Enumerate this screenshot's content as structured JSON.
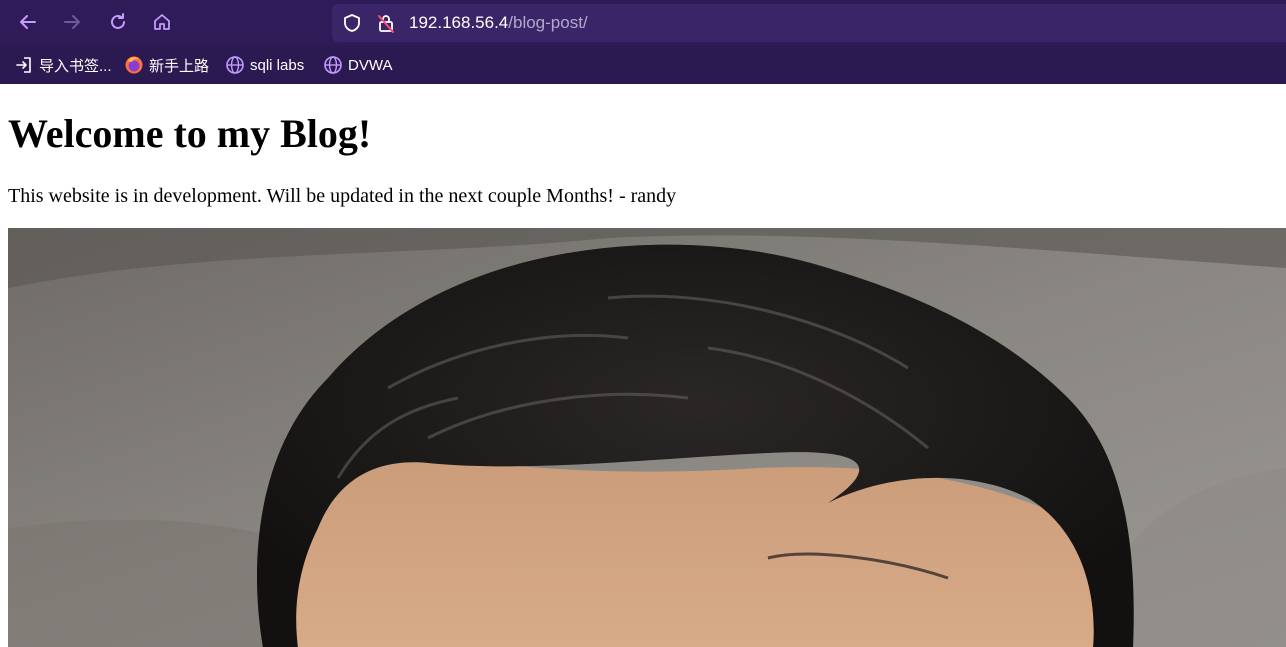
{
  "browser": {
    "url_host": "192.168.56.4",
    "url_path": "/blog-post/",
    "theme_color": "#2b1a52",
    "icon_color": "#c49bff",
    "bookmarks": [
      {
        "label": "导入书签...",
        "icon": "import-bookmarks-icon"
      },
      {
        "label": "新手上路",
        "icon": "firefox-icon"
      },
      {
        "label": "sqli labs",
        "icon": "globe-icon"
      },
      {
        "label": "DVWA",
        "icon": "globe-icon"
      }
    ]
  },
  "page": {
    "title": "Welcome to my Blog!",
    "intro": "This website is in development. Will be updated in the next couple Months! - randy",
    "photo": "portrait-photo-of-man-with-dark-hair"
  }
}
